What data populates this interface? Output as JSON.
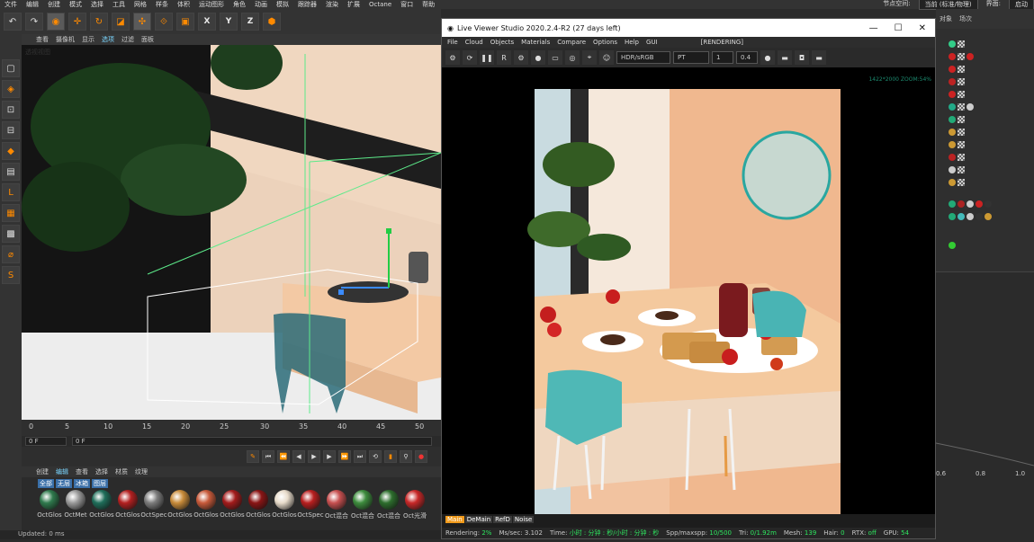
{
  "menubar": {
    "items": [
      "文件",
      "编辑",
      "创建",
      "模式",
      "选择",
      "工具",
      "网格",
      "样条",
      "体积",
      "运动图形",
      "角色",
      "动画",
      "模拟",
      "跟踪器",
      "渲染",
      "扩展",
      "Octane",
      "窗口",
      "帮助"
    ],
    "node_space_label": "节点空间:",
    "node_space_value": "当前 (标准/物理)",
    "interface_label": "界面:",
    "interface_value": "启动"
  },
  "viewport": {
    "menu": [
      "查看",
      "摄像机",
      "显示",
      "选项",
      "过滤",
      "面板"
    ],
    "active_menu": "选项",
    "label": "透视视图"
  },
  "timeline": {
    "ticks": [
      "0",
      "5",
      "10",
      "15",
      "20",
      "25",
      "30",
      "35",
      "40",
      "45",
      "50"
    ],
    "start_frame": "0 F",
    "current_frame": "0 F"
  },
  "materials": {
    "menu": [
      "创建",
      "编辑",
      "查看",
      "选择",
      "材质",
      "纹理"
    ],
    "active_menu": "编辑",
    "filters": [
      "全部",
      "无层",
      "冰箱",
      "图层"
    ],
    "items": [
      {
        "label": "OctGlos",
        "color": "#2f7a4d"
      },
      {
        "label": "OctMet",
        "color": "#9a9a9a"
      },
      {
        "label": "OctGlos",
        "color": "#1f6e5a"
      },
      {
        "label": "OctGlos",
        "color": "#b32020"
      },
      {
        "label": "OctSpec",
        "color": "#7c7c7c"
      },
      {
        "label": "OctGlos",
        "color": "#c98c3a"
      },
      {
        "label": "OctGlos",
        "color": "#c85a3a"
      },
      {
        "label": "OctGlos",
        "color": "#a31b1b"
      },
      {
        "label": "OctGlos",
        "color": "#8a1414"
      },
      {
        "label": "OctGlos",
        "color": "#e8dccb"
      },
      {
        "label": "OctSpec",
        "color": "#b81f1f"
      },
      {
        "label": "Oct混合",
        "color": "#c75050"
      },
      {
        "label": "Oct混合",
        "color": "#3d8c3d"
      },
      {
        "label": "Oct混合",
        "color": "#2d6e2d"
      },
      {
        "label": "Oct光滑",
        "color": "#c82828"
      }
    ]
  },
  "status": {
    "text": "Updated: 0 ms"
  },
  "live_viewer": {
    "title": "Live Viewer Studio 2020.2.4-R2 (27 days left)",
    "menu": [
      "File",
      "Cloud",
      "Objects",
      "Materials",
      "Compare",
      "Options",
      "Help",
      "GUI",
      "[RENDERING]"
    ],
    "color_space": "HDR/sRGB",
    "kernel": "PT",
    "value_1": "1",
    "value_2": "0.4",
    "resolution_text": "1422*2000 ZOOM:54%",
    "passes": [
      "Main",
      "DeMain",
      "RefD",
      "Noise"
    ],
    "active_pass": "Main",
    "status": {
      "rendering_label": "Rendering:",
      "rendering_value": "2%",
      "ms_label": "Ms/sec:",
      "ms_value": "3.102",
      "time_label": "Time:",
      "time_value": "小时 : 分钟 : 秒/小时 : 分钟 : 秒",
      "spp_label": "Spp/maxspp:",
      "spp_value": "10/500",
      "tri_label": "Tri:",
      "tri_value": "0/1.92m",
      "mesh_label": "Mesh:",
      "mesh_value": "139",
      "hair_label": "Hair:",
      "hair_value": "0",
      "rtx_label": "RTX:",
      "rtx_value": "off",
      "gpu_label": "GPU:",
      "gpu_value": "54"
    }
  },
  "right_panel": {
    "tabs": [
      "对象",
      "场次"
    ],
    "graph_labels": [
      "0.6",
      "0.8",
      "1.0"
    ]
  }
}
